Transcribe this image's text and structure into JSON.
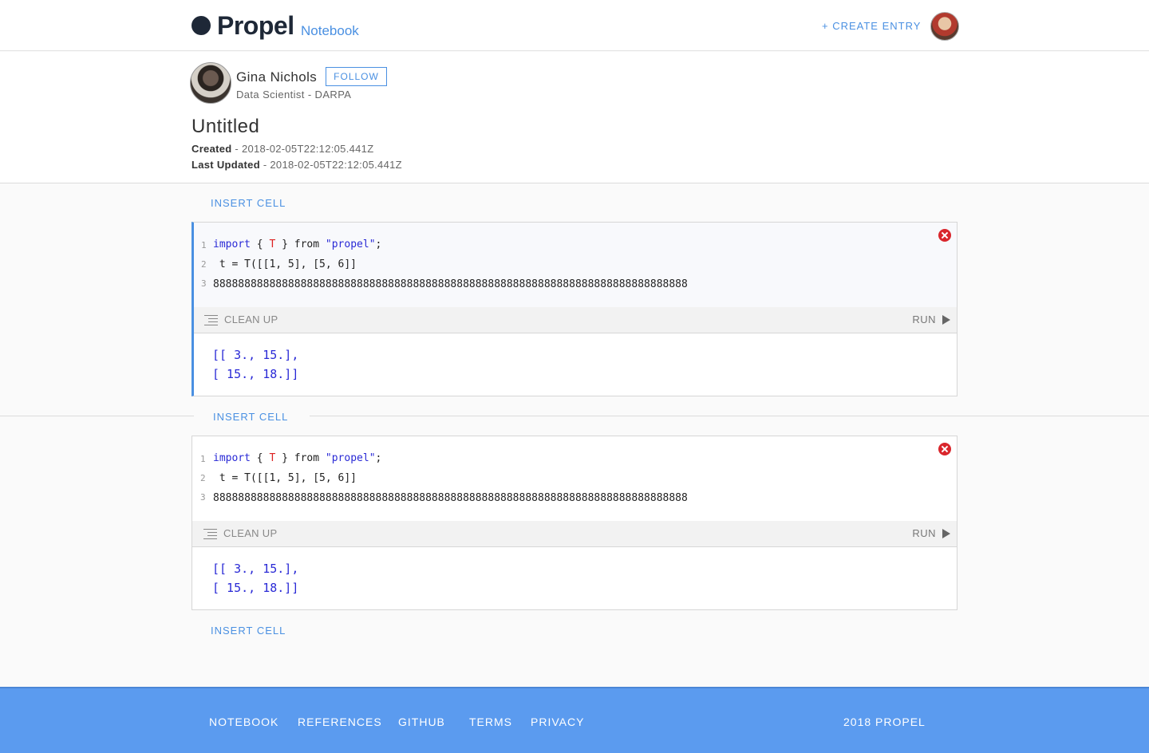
{
  "header": {
    "logo": "Propel",
    "logo_sub": "Notebook",
    "create_entry": "+ CREATE ENTRY"
  },
  "author": {
    "name": "Gina Nichols",
    "follow_label": "FOLLOW",
    "title": "Data Scientist - DARPA"
  },
  "notebook": {
    "title": "Untitled",
    "created_label": "Created",
    "created_value": " - 2018-02-05T22:12:05.441Z",
    "updated_label": "Last Updated",
    "updated_value": " - 2018-02-05T22:12:05.441Z"
  },
  "insert_cell_label": "INSERT CELL",
  "cells": [
    {
      "line_numbers": [
        "1",
        "2",
        "3"
      ],
      "code": {
        "l1_import": "import",
        "l1_open": " { ",
        "l1_T": "T",
        "l1_from": " } from ",
        "l1_str": "\"propel\"",
        "l1_end": ";",
        "l2": " t = T([[1, 5], [5, 6]]",
        "l3": "8888888888888888888888888888888888888888888888888888888888888888888888888888"
      },
      "cleanup_label": "CLEAN UP",
      "run_label": "RUN",
      "output": [
        "[[ 3., 15.],",
        "[ 15., 18.]]"
      ]
    },
    {
      "line_numbers": [
        "1",
        "2",
        "3"
      ],
      "code": {
        "l1_import": "import",
        "l1_open": " { ",
        "l1_T": "T",
        "l1_from": " } from ",
        "l1_str": "\"propel\"",
        "l1_end": ";",
        "l2": " t = T([[1, 5], [5, 6]]",
        "l3": "8888888888888888888888888888888888888888888888888888888888888888888888888888"
      },
      "cleanup_label": "CLEAN UP",
      "run_label": "RUN",
      "output": [
        "[[ 3., 15.],",
        "[ 15., 18.]]"
      ]
    }
  ],
  "footer": {
    "links": [
      "NOTEBOOK",
      "REFERENCES",
      "GITHUB",
      "TERMS",
      "PRIVACY"
    ],
    "copyright": "2018 PROPEL"
  },
  "colors": {
    "accent": "#4a90e2",
    "footer_bg": "#5b9bef",
    "close": "#d9262c",
    "code_keyword": "#2a2ad6",
    "code_var": "#dd2222"
  },
  "icons": [
    "close-icon",
    "lines-icon",
    "play-icon"
  ]
}
